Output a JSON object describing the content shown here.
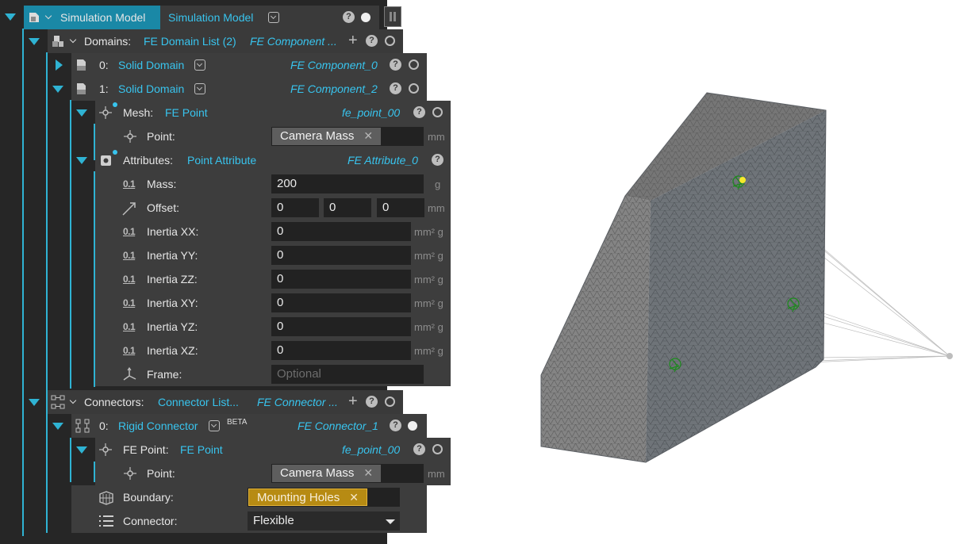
{
  "root": {
    "title": "Simulation Model",
    "selector": "Simulation Model"
  },
  "domains": {
    "label": "Domains:",
    "type": "FE Domain List (2)",
    "ref": "FE Component ..."
  },
  "domain0": {
    "index": "0:",
    "type": "Solid Domain",
    "ref": "FE Component_0"
  },
  "domain1": {
    "index": "1:",
    "type": "Solid Domain",
    "ref": "FE Component_2"
  },
  "mesh": {
    "label": "Mesh:",
    "type": "FE Point",
    "ref": "fe_point_00",
    "point_label": "Point:",
    "point_value": "Camera Mass",
    "point_unit": "mm"
  },
  "attributes": {
    "label": "Attributes:",
    "type": "Point Attribute",
    "ref": "FE Attribute_0",
    "mass_label": "Mass:",
    "mass_value": "200",
    "mass_unit": "g",
    "offset_label": "Offset:",
    "offset_x": "0",
    "offset_y": "0",
    "offset_z": "0",
    "offset_unit": "mm",
    "inertia": [
      {
        "label": "Inertia XX:",
        "value": "0"
      },
      {
        "label": "Inertia YY:",
        "value": "0"
      },
      {
        "label": "Inertia ZZ:",
        "value": "0"
      },
      {
        "label": "Inertia XY:",
        "value": "0"
      },
      {
        "label": "Inertia YZ:",
        "value": "0"
      },
      {
        "label": "Inertia XZ:",
        "value": "0"
      }
    ],
    "inertia_unit": "mm² g",
    "frame_label": "Frame:",
    "frame_placeholder": "Optional"
  },
  "connectors": {
    "label": "Connectors:",
    "type": "Connector List...",
    "ref": "FE Connector ..."
  },
  "connector0": {
    "index": "0:",
    "type": "Rigid Connector",
    "badge": "BETA",
    "ref": "FE Connector_1"
  },
  "fe_point": {
    "label": "FE Point:",
    "type": "FE Point",
    "ref": "fe_point_00",
    "point_label": "Point:",
    "point_value": "Camera Mass",
    "point_unit": "mm"
  },
  "boundary": {
    "label": "Boundary:",
    "value": "Mounting Holes"
  },
  "connector_mode": {
    "label": "Connector:",
    "value": "Flexible"
  },
  "colors": {
    "accent": "#38c4ee",
    "panel": "#3d3d3d",
    "highlight": "#b78b13",
    "mesh": "#6f7479"
  },
  "icons": [
    "model-icon",
    "solid-domain-icon",
    "point-icon",
    "attribute-icon",
    "value-icon",
    "offset-icon",
    "frame-icon",
    "connector-icon",
    "boundary-icon",
    "list-icon",
    "help-icon",
    "pause-icon"
  ]
}
